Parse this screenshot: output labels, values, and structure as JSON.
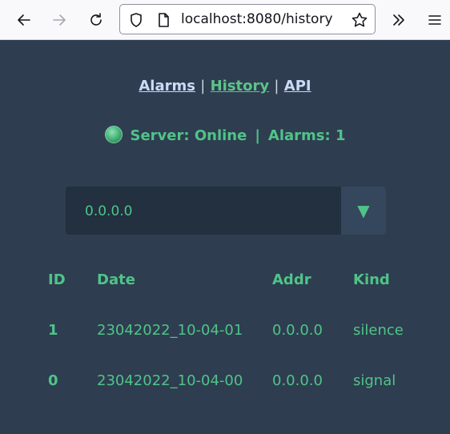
{
  "browser": {
    "url": "localhost:8080/history"
  },
  "nav": {
    "alarms": "Alarms",
    "history": "History",
    "api": "API",
    "sep": "|"
  },
  "status": {
    "server": "Server: Online",
    "bar": "|",
    "alarms": "Alarms: 1",
    "indicator_color": "#4fc488"
  },
  "filter": {
    "selected": "0.0.0.0",
    "arrow": "▼"
  },
  "table": {
    "headers": [
      "ID",
      "Date",
      "Addr",
      "Kind"
    ],
    "rows": [
      [
        "1",
        "23042022_10-04-01",
        "0.0.0.0",
        "silence"
      ],
      [
        "0",
        "23042022_10-04-00",
        "0.0.0.0",
        "signal"
      ]
    ]
  },
  "colors": {
    "background": "#2e3d50",
    "accent": "#4fc488",
    "select_bg": "#22303f"
  }
}
